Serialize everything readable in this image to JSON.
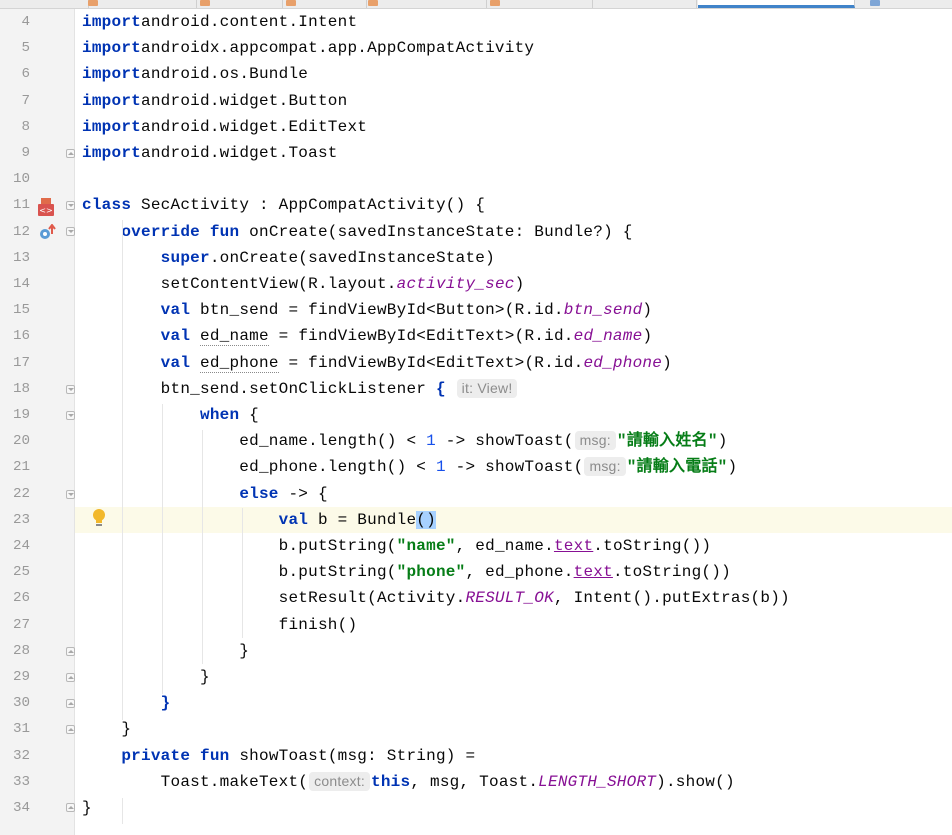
{
  "colors": {
    "keyword": "#0033b3",
    "string": "#067d17",
    "number": "#1750eb",
    "italic_member": "#871094",
    "line_number": "#999999",
    "current_line": "#fcfae8",
    "gutter": "#f3f3f3",
    "active_tab": "#4083c9"
  },
  "gutter_icons": {
    "line11": "xml-layout-icon",
    "line12": "override-method-icon",
    "line23": "lightbulb-intention-icon"
  },
  "editor": {
    "current_line": 23,
    "lines": [
      {
        "n": "4",
        "t": [
          [
            "kw",
            "import"
          ],
          [
            "",
            "android.content.Intent"
          ]
        ]
      },
      {
        "n": "5",
        "t": [
          [
            "kw",
            "import"
          ],
          [
            "",
            "androidx.appcompat.app.AppCompatActivity"
          ]
        ]
      },
      {
        "n": "6",
        "t": [
          [
            "kw",
            "import"
          ],
          [
            "",
            "android.os.Bundle"
          ]
        ]
      },
      {
        "n": "7",
        "t": [
          [
            "kw",
            "import"
          ],
          [
            "",
            "android.widget.Button"
          ]
        ]
      },
      {
        "n": "8",
        "t": [
          [
            "kw",
            "import"
          ],
          [
            "",
            "android.widget.EditText"
          ]
        ]
      },
      {
        "n": "9",
        "t": [
          [
            "kw",
            "import"
          ],
          [
            "",
            "android.widget.Toast"
          ]
        ]
      },
      {
        "n": "10",
        "t": []
      },
      {
        "n": "11",
        "t": [
          [
            "kw",
            "class"
          ],
          [
            "",
            " SecActivity : AppCompatActivity() {"
          ]
        ]
      },
      {
        "n": "12",
        "t": [
          [
            "",
            "    "
          ],
          [
            "kw",
            "override"
          ],
          [
            "",
            " "
          ],
          [
            "kw",
            "fun"
          ],
          [
            "",
            " onCreate(savedInstanceState: Bundle?) {"
          ]
        ]
      },
      {
        "n": "13",
        "t": [
          [
            "",
            "        "
          ],
          [
            "kw",
            "super"
          ],
          [
            "",
            ".onCreate(savedInstanceState)"
          ]
        ]
      },
      {
        "n": "14",
        "t": [
          [
            "",
            "        setContentView(R.layout."
          ],
          [
            "ital",
            "activity_sec"
          ],
          [
            "",
            ")"
          ]
        ]
      },
      {
        "n": "15",
        "t": [
          [
            "",
            "        "
          ],
          [
            "kw",
            "val"
          ],
          [
            "",
            " btn_send = findViewById<Button>(R.id."
          ],
          [
            "ital",
            "btn_send"
          ],
          [
            "",
            ")"
          ]
        ]
      },
      {
        "n": "16",
        "t": [
          [
            "",
            "        "
          ],
          [
            "kw",
            "val"
          ],
          [
            "",
            " "
          ],
          [
            "dotted",
            "ed_name"
          ],
          [
            "",
            " = findViewById<EditText>(R.id."
          ],
          [
            "ital",
            "ed_name"
          ],
          [
            "",
            ")"
          ]
        ]
      },
      {
        "n": "17",
        "t": [
          [
            "",
            "        "
          ],
          [
            "kw",
            "val"
          ],
          [
            "",
            " "
          ],
          [
            "dotted",
            "ed_phone"
          ],
          [
            "",
            " = findViewById<EditText>(R.id."
          ],
          [
            "ital",
            "ed_phone"
          ],
          [
            "",
            ")"
          ]
        ]
      },
      {
        "n": "18",
        "t": [
          [
            "",
            "        btn_send.setOnClickListener "
          ],
          [
            "kw",
            "{"
          ],
          [
            "",
            " "
          ],
          [
            "hint",
            "it: View!"
          ]
        ]
      },
      {
        "n": "19",
        "t": [
          [
            "",
            "            "
          ],
          [
            "kw",
            "when"
          ],
          [
            "",
            " {"
          ]
        ]
      },
      {
        "n": "20",
        "t": [
          [
            "",
            "                ed_name.length() < "
          ],
          [
            "num",
            "1"
          ],
          [
            "",
            " -> showToast("
          ],
          [
            "hint",
            "msg:"
          ],
          [
            "str",
            "\"請輸入姓名\""
          ],
          [
            "",
            ")"
          ]
        ]
      },
      {
        "n": "21",
        "t": [
          [
            "",
            "                ed_phone.length() < "
          ],
          [
            "num",
            "1"
          ],
          [
            "",
            " -> showToast("
          ],
          [
            "hint",
            "msg:"
          ],
          [
            "str",
            "\"請輸入電話\""
          ],
          [
            "",
            ")"
          ]
        ]
      },
      {
        "n": "22",
        "t": [
          [
            "",
            "                "
          ],
          [
            "kw",
            "else"
          ],
          [
            "",
            " -> {"
          ]
        ]
      },
      {
        "n": "23",
        "t": [
          [
            "",
            "                    "
          ],
          [
            "kw",
            "val"
          ],
          [
            "",
            " b = Bundle"
          ],
          [
            "sel",
            "()"
          ]
        ]
      },
      {
        "n": "24",
        "t": [
          [
            "",
            "                    b.putString("
          ],
          [
            "str",
            "\"name\""
          ],
          [
            "",
            ", ed_name."
          ],
          [
            "prop",
            "text"
          ],
          [
            "",
            ".toString())"
          ]
        ]
      },
      {
        "n": "25",
        "t": [
          [
            "",
            "                    b.putString("
          ],
          [
            "str",
            "\"phone\""
          ],
          [
            "",
            ", ed_phone."
          ],
          [
            "prop",
            "text"
          ],
          [
            "",
            ".toString())"
          ]
        ]
      },
      {
        "n": "26",
        "t": [
          [
            "",
            "                    setResult(Activity."
          ],
          [
            "ital",
            "RESULT_OK"
          ],
          [
            "",
            ", Intent().putExtras(b))"
          ]
        ]
      },
      {
        "n": "27",
        "t": [
          [
            "",
            "                    finish()"
          ]
        ]
      },
      {
        "n": "28",
        "t": [
          [
            "",
            "                }"
          ]
        ]
      },
      {
        "n": "29",
        "t": [
          [
            "",
            "            }"
          ]
        ]
      },
      {
        "n": "30",
        "t": [
          [
            "",
            "        "
          ],
          [
            "kw",
            "}"
          ]
        ]
      },
      {
        "n": "31",
        "t": [
          [
            "",
            "    }"
          ]
        ]
      },
      {
        "n": "32",
        "t": [
          [
            "",
            "    "
          ],
          [
            "kw",
            "private"
          ],
          [
            "",
            " "
          ],
          [
            "kw",
            "fun"
          ],
          [
            "",
            " showToast(msg: String) ="
          ]
        ]
      },
      {
        "n": "33",
        "t": [
          [
            "",
            "        Toast.makeText("
          ],
          [
            "hint",
            "context:"
          ],
          [
            "kw",
            "this"
          ],
          [
            "",
            ", msg, Toast."
          ],
          [
            "ital",
            "LENGTH_SHORT"
          ],
          [
            "",
            ").show()"
          ]
        ]
      },
      {
        "n": "34",
        "t": [
          [
            "",
            "}"
          ]
        ]
      }
    ]
  }
}
